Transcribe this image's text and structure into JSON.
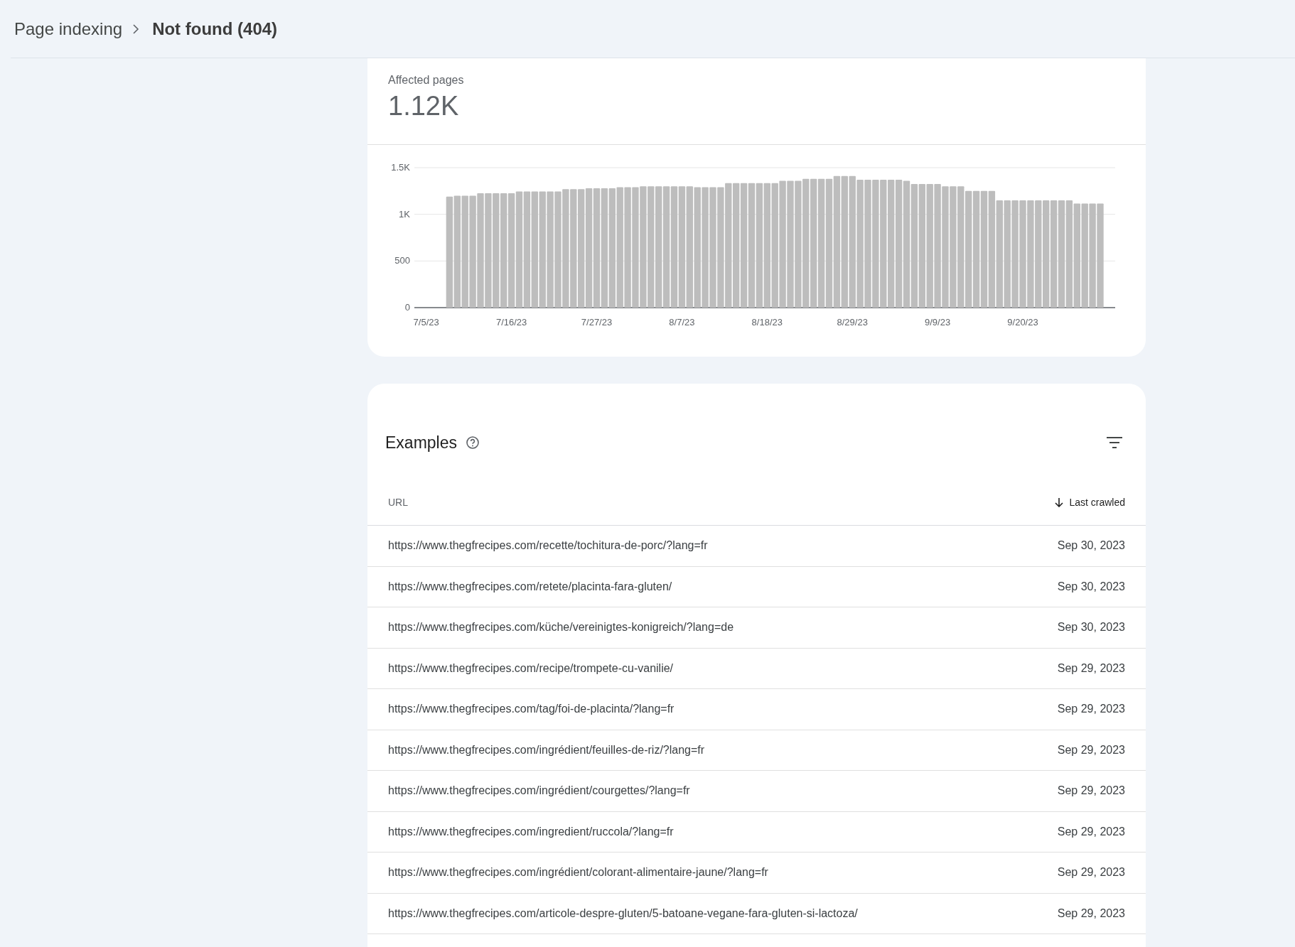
{
  "breadcrumb": {
    "parent": "Page indexing",
    "current": "Not found (404)"
  },
  "summary": {
    "label": "Affected pages",
    "value": "1.12K",
    "chart_data": {
      "type": "bar",
      "categories": [
        "7/5/23",
        null,
        null,
        null,
        null,
        null,
        null,
        null,
        null,
        null,
        null,
        "7/16/23",
        null,
        null,
        null,
        null,
        null,
        null,
        null,
        null,
        null,
        null,
        "7/27/23",
        null,
        null,
        null,
        null,
        null,
        null,
        null,
        null,
        null,
        null,
        "8/7/23",
        null,
        null,
        null,
        null,
        null,
        null,
        null,
        null,
        null,
        null,
        "8/18/23",
        null,
        null,
        null,
        null,
        null,
        null,
        null,
        null,
        null,
        null,
        "8/29/23",
        null,
        null,
        null,
        null,
        null,
        null,
        null,
        null,
        null,
        null,
        "9/9/23",
        null,
        null,
        null,
        null,
        null,
        null,
        null,
        null,
        null,
        null,
        "9/20/23",
        null,
        null,
        null,
        null,
        null,
        null,
        null,
        null,
        null,
        null
      ],
      "series": [
        {
          "color": "#bdbdbd",
          "values": [
            null,
            null,
            null,
            1190,
            1200,
            1200,
            1200,
            1225,
            1225,
            1225,
            1225,
            1225,
            1245,
            1245,
            1245,
            1245,
            1245,
            1245,
            1270,
            1270,
            1270,
            1280,
            1280,
            1280,
            1280,
            1290,
            1290,
            1290,
            1300,
            1300,
            1300,
            1300,
            1300,
            1300,
            1300,
            1290,
            1290,
            1290,
            1290,
            1335,
            1335,
            1335,
            1335,
            1335,
            1335,
            1335,
            1360,
            1360,
            1360,
            1380,
            1380,
            1380,
            1380,
            1410,
            1410,
            1410,
            1370,
            1370,
            1370,
            1370,
            1370,
            1370,
            1360,
            1325,
            1325,
            1325,
            1325,
            1300,
            1300,
            1300,
            1250,
            1250,
            1250,
            1250,
            1150,
            1150,
            1150,
            1150,
            1150,
            1150,
            1150,
            1150,
            1150,
            1150,
            1115,
            1115,
            1115,
            1115
          ]
        }
      ],
      "ylim": [
        0,
        1500
      ],
      "yticks": [
        0,
        500,
        {
          "value": 1000,
          "label": "1K"
        },
        {
          "value": 1500,
          "label": "1.5K"
        }
      ]
    }
  },
  "examples": {
    "title": "Examples",
    "columns": [
      {
        "label": "URL",
        "sorted": false
      },
      {
        "label": "Last crawled",
        "sorted": true
      }
    ],
    "rows": [
      {
        "url": "https://www.thegfrecipes.com/recette/tochitura-de-porc/?lang=fr",
        "date": "Sep 30, 2023"
      },
      {
        "url": "https://www.thegfrecipes.com/retete/placinta-fara-gluten/",
        "date": "Sep 30, 2023"
      },
      {
        "url": "https://www.thegfrecipes.com/küche/vereinigtes-konigreich/?lang=de",
        "date": "Sep 30, 2023"
      },
      {
        "url": "https://www.thegfrecipes.com/recipe/trompete-cu-vanilie/",
        "date": "Sep 29, 2023"
      },
      {
        "url": "https://www.thegfrecipes.com/tag/foi-de-placinta/?lang=fr",
        "date": "Sep 29, 2023"
      },
      {
        "url": "https://www.thegfrecipes.com/ingrédient/feuilles-de-riz/?lang=fr",
        "date": "Sep 29, 2023"
      },
      {
        "url": "https://www.thegfrecipes.com/ingrédient/courgettes/?lang=fr",
        "date": "Sep 29, 2023"
      },
      {
        "url": "https://www.thegfrecipes.com/ingredient/ruccola/?lang=fr",
        "date": "Sep 29, 2023"
      },
      {
        "url": "https://www.thegfrecipes.com/ingrédient/colorant-alimentaire-jaune/?lang=fr",
        "date": "Sep 29, 2023"
      },
      {
        "url": "https://www.thegfrecipes.com/articole-despre-gluten/5-batoane-vegane-fara-gluten-si-lactoza/",
        "date": "Sep 29, 2023"
      }
    ]
  }
}
